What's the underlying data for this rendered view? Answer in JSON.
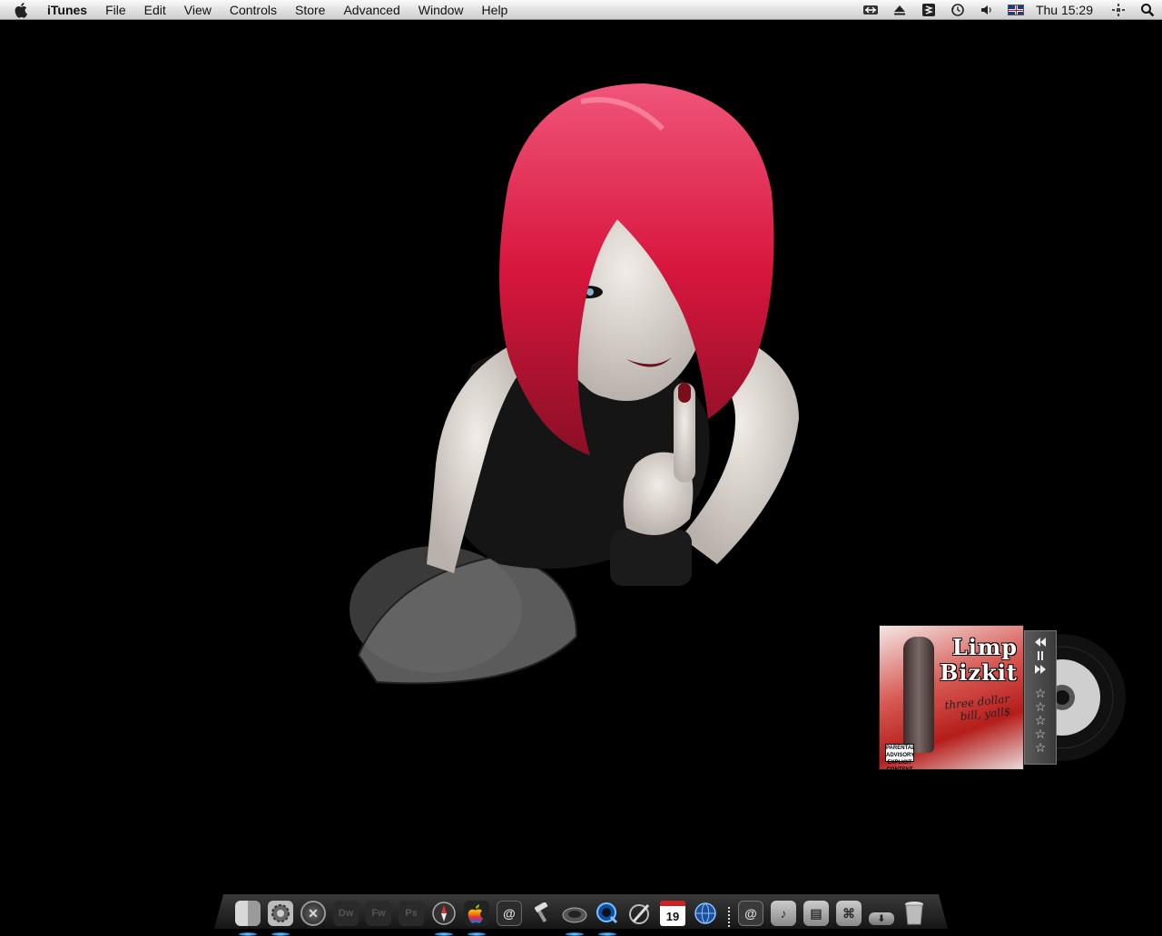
{
  "menubar": {
    "apple_icon": "apple-logo-icon",
    "app_name": "iTunes",
    "menus": [
      "File",
      "Edit",
      "View",
      "Controls",
      "Store",
      "Advanced",
      "Window",
      "Help"
    ],
    "tray_icons": [
      "teamviewer-icon",
      "eject-icon",
      "growl-icon",
      "time-machine-icon",
      "volume-icon",
      "uk-flag-input-icon"
    ],
    "clock": "Thu 15:29",
    "extras": [
      "spaces-icon",
      "spotlight-search-icon"
    ]
  },
  "itunes_widget": {
    "artist_art_text": "Limp Bizkit",
    "album_art_text": "three dollar bill, yall$",
    "advisory_text": "PARENTAL ADVISORY EXPLICIT CONTENT",
    "controls": [
      "rewind-icon",
      "pause-icon",
      "fast-forward-icon"
    ],
    "rating_stars": 5
  },
  "dock": {
    "apps": [
      {
        "name": "Finder",
        "icon": "finder-icon",
        "running": true
      },
      {
        "name": "System Preferences",
        "icon": "system-preferences-icon",
        "running": true
      },
      {
        "name": "Mac OS X",
        "icon": "mac-os-x-icon",
        "running": false
      },
      {
        "name": "Dreamweaver",
        "icon": "dreamweaver-icon",
        "running": false,
        "label": "Dw"
      },
      {
        "name": "Fireworks",
        "icon": "fireworks-icon",
        "running": false,
        "label": "Fw"
      },
      {
        "name": "Photoshop",
        "icon": "photoshop-icon",
        "running": false,
        "label": "Ps"
      },
      {
        "name": "Safari",
        "icon": "safari-compass-icon",
        "running": true
      },
      {
        "name": "Apple",
        "icon": "apple-app-icon",
        "running": true
      },
      {
        "name": "Address Book",
        "icon": "address-book-icon",
        "running": false
      },
      {
        "name": "Script Editor",
        "icon": "script-hammer-icon",
        "running": false
      },
      {
        "name": "Speaker",
        "icon": "speaker-icon",
        "running": true
      },
      {
        "name": "QuickTime",
        "icon": "quicktime-icon",
        "running": true
      },
      {
        "name": "Preview",
        "icon": "paintbrush-icon",
        "running": false
      },
      {
        "name": "iCal",
        "icon": "calendar-icon",
        "running": false,
        "label": "19"
      },
      {
        "name": "Network",
        "icon": "globe-icon",
        "running": false
      }
    ],
    "stacks": [
      {
        "name": "Mail Stack",
        "icon": "mail-stack-icon"
      },
      {
        "name": "Music Folder",
        "icon": "music-folder-icon"
      },
      {
        "name": "Documents Folder",
        "icon": "documents-folder-icon"
      },
      {
        "name": "Applications Folder",
        "icon": "applications-folder-icon"
      },
      {
        "name": "Downloads",
        "icon": "downloads-icon"
      },
      {
        "name": "Trash",
        "icon": "trash-icon"
      }
    ]
  }
}
